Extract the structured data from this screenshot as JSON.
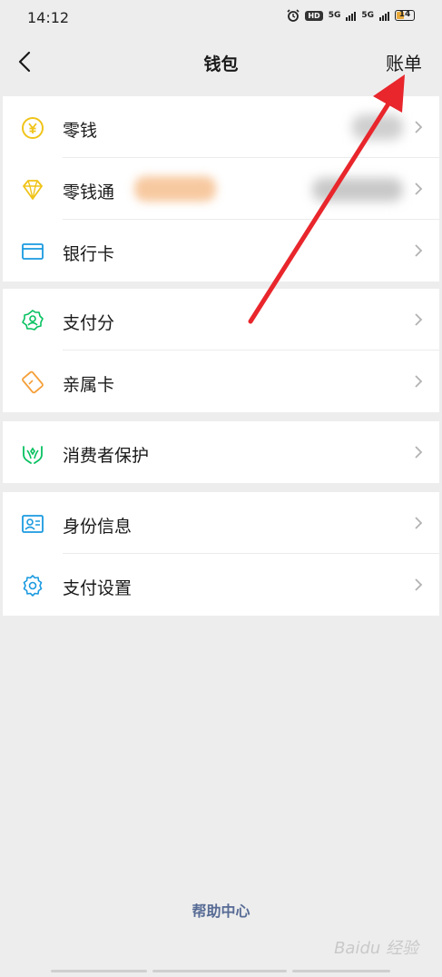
{
  "status_bar": {
    "time": "14:12",
    "hd": "HD",
    "network_1": "5G",
    "network_2": "5G",
    "battery": "14"
  },
  "nav": {
    "title": "钱包",
    "right_action": "账单"
  },
  "groups": [
    {
      "items": [
        {
          "label": "零钱",
          "icon": "yuan-coin-icon",
          "color": "#f0c419"
        },
        {
          "label": "零钱通",
          "icon": "diamond-icon",
          "color": "#f0c419"
        },
        {
          "label": "银行卡",
          "icon": "bank-card-icon",
          "color": "#1a9ae0"
        }
      ]
    },
    {
      "items": [
        {
          "label": "支付分",
          "icon": "score-badge-icon",
          "color": "#07c160"
        },
        {
          "label": "亲属卡",
          "icon": "family-card-icon",
          "color": "#f5a03a"
        }
      ]
    },
    {
      "items": [
        {
          "label": "消费者保护",
          "icon": "protection-hands-icon",
          "color": "#07c160"
        }
      ]
    },
    {
      "items": [
        {
          "label": "身份信息",
          "icon": "id-card-icon",
          "color": "#1a9ae0"
        },
        {
          "label": "支付设置",
          "icon": "settings-gear-icon",
          "color": "#1a9ae0"
        }
      ]
    }
  ],
  "footer": {
    "help_center": "帮助中心"
  },
  "watermark": "Baidu 经验",
  "colors": {
    "accent_link": "#576b95",
    "annotation_arrow": "#e8262c"
  }
}
